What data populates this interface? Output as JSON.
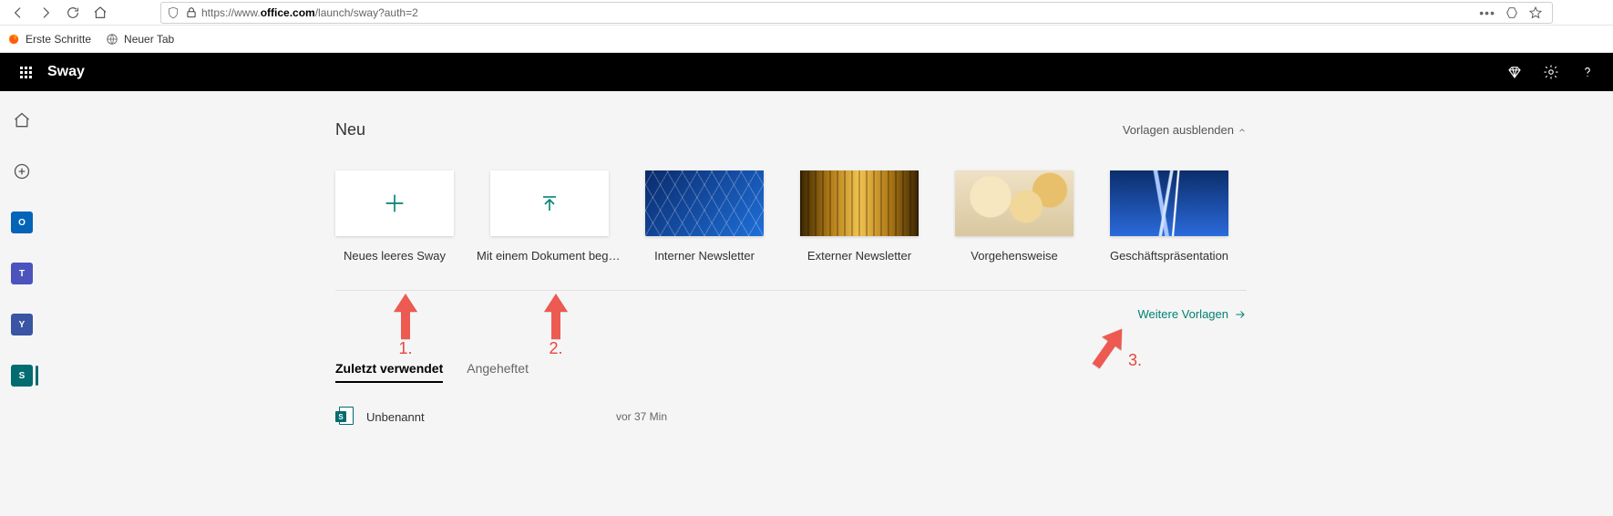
{
  "browser": {
    "url_prefix": "https://www.",
    "url_host": "office.com",
    "url_path": "/launch/sway?auth=2",
    "bookmarks": {
      "first_steps": "Erste Schritte",
      "new_tab": "Neuer Tab"
    }
  },
  "header": {
    "app_title": "Sway"
  },
  "rail_apps": {
    "outlook": "O",
    "teams": "T",
    "yammer": "Y",
    "sway": "S"
  },
  "new_section": {
    "title": "Neu",
    "hide_templates": "Vorlagen ausblenden",
    "tiles": {
      "blank": "Neues leeres Sway",
      "from_doc": "Mit einem Dokument begi…",
      "internal_news": "Interner Newsletter",
      "external_news": "Externer Newsletter",
      "howto": "Vorgehensweise",
      "biz_pres": "Geschäftspräsentation"
    },
    "more_templates": "Weitere Vorlagen"
  },
  "tabs": {
    "recent": "Zuletzt verwendet",
    "pinned": "Angeheftet"
  },
  "recent": {
    "items": [
      {
        "name": "Unbenannt",
        "time": "vor 37 Min"
      }
    ]
  },
  "annotations": {
    "a1": "1.",
    "a2": "2.",
    "a3": "3."
  }
}
